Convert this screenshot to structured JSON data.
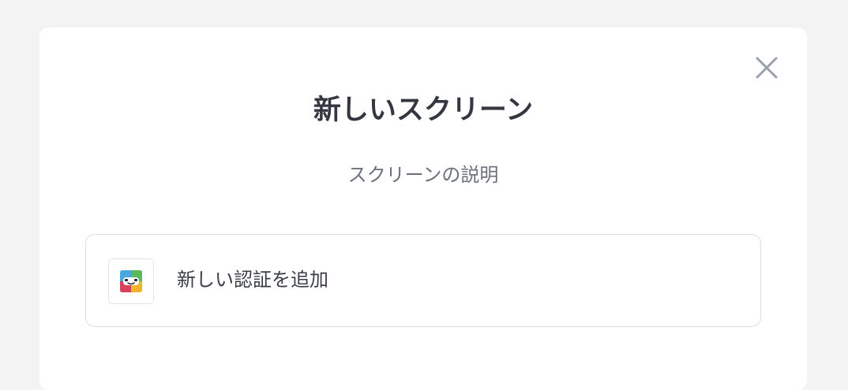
{
  "dialog": {
    "title": "新しいスクリーン",
    "subtitle": "スクリーンの説明",
    "close_icon": "close-icon"
  },
  "options": [
    {
      "icon": "authenticator-app-icon",
      "label": "新しい認証を追加"
    }
  ],
  "colors": {
    "background": "#f3f3f3",
    "card": "#ffffff",
    "title_text": "#333740",
    "subtitle_text": "#6a717b",
    "border": "#dcdfe4",
    "close_icon": "#9aa1ab"
  }
}
